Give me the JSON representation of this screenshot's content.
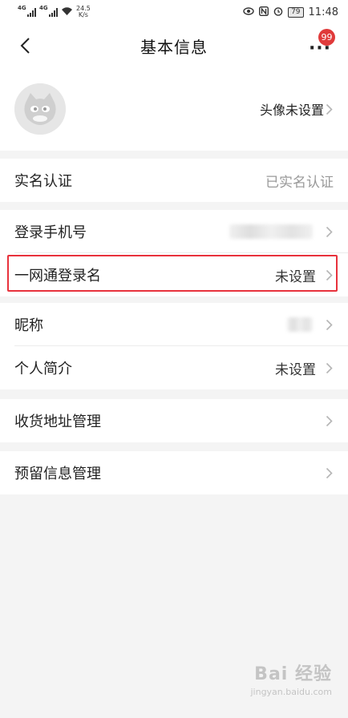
{
  "status_bar": {
    "signal1_tag": "4G",
    "signal2_tag": "4G",
    "speed_value": "24.5",
    "speed_unit": "K/s",
    "battery": "79",
    "time": "11:48",
    "icons": [
      "eye-icon",
      "nfc-icon",
      "alarm-icon",
      "battery-icon"
    ]
  },
  "nav": {
    "title": "基本信息",
    "badge": "99",
    "more_label": "···"
  },
  "profile": {
    "avatar_value": "头像未设置"
  },
  "rows": {
    "real_name": {
      "label": "实名认证",
      "value": "已实名认证"
    },
    "phone": {
      "label": "登录手机号",
      "value": ""
    },
    "login_name": {
      "label": "一网通登录名",
      "value": "未设置"
    },
    "nickname": {
      "label": "昵称",
      "value": ""
    },
    "bio": {
      "label": "个人简介",
      "value": "未设置"
    },
    "address": {
      "label": "收货地址管理"
    },
    "reserved_info": {
      "label": "预留信息管理"
    }
  },
  "watermark": {
    "brand": "Bai 经验",
    "url": "jingyan.baidu.com"
  },
  "colors": {
    "highlight": "#e8323c",
    "badge": "#e03a3a",
    "background": "#f4f4f4"
  }
}
